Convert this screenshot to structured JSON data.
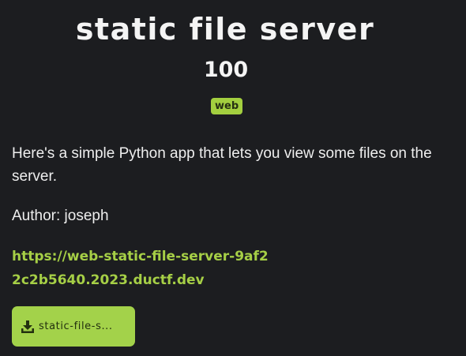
{
  "challenge": {
    "title": "static file server",
    "points": "100",
    "tag": "web",
    "description": "Here's a simple Python app that lets you view some files on the server.",
    "author": "Author: joseph",
    "url": "https://web-static-file-server-9af22c2b5640.2023.ductf.dev",
    "download_label": "static-file-s...",
    "download_icon": "download-icon"
  },
  "colors": {
    "background": "#1c1d20",
    "accent": "#a3d24a",
    "link": "#a6cf46",
    "text": "#f4f4f4"
  }
}
